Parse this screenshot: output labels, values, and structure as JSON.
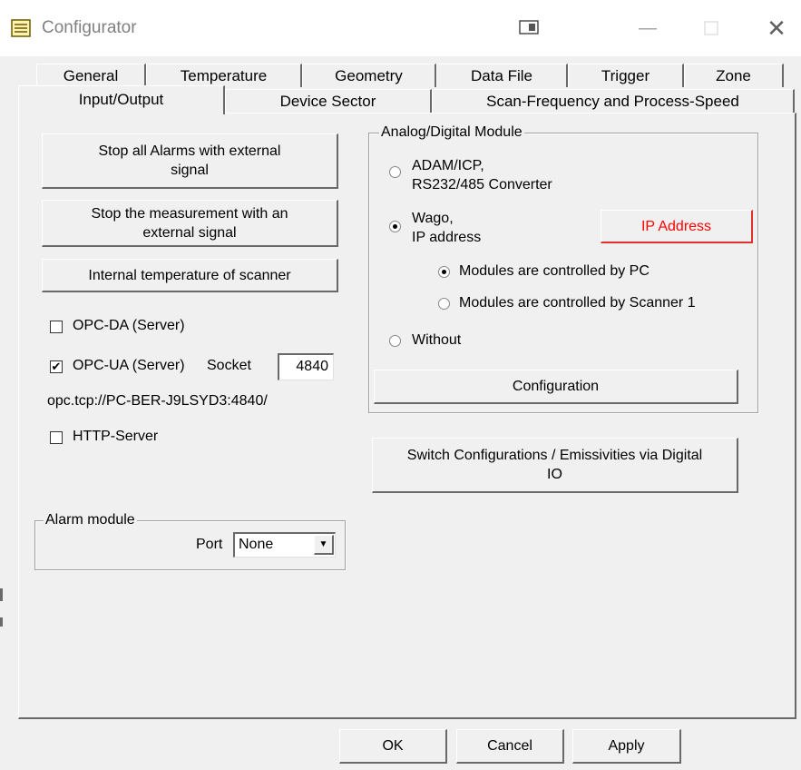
{
  "window": {
    "title": "Configurator",
    "minimize_glyph": "—",
    "close_glyph": "✕"
  },
  "tabs": {
    "row1": [
      "General",
      "Temperature",
      "Geometry",
      "Data File",
      "Trigger",
      "Zone"
    ],
    "row2": [
      "Input/Output",
      "Device Sector",
      "Scan-Frequency and Process-Speed"
    ],
    "active": "Input/Output"
  },
  "left": {
    "stop_alarms_label": "Stop all Alarms with external signal",
    "stop_measurement_label": "Stop the measurement with an external signal",
    "internal_temp_label": "Internal temperature of scanner",
    "opc_da": {
      "label": "OPC-DA (Server)",
      "checked": false
    },
    "opc_ua": {
      "label": "OPC-UA (Server)",
      "checked": true
    },
    "socket_label": "Socket",
    "socket_value": "4840",
    "opc_url": "opc.tcp://PC-BER-J9LSYD3:4840/",
    "http_server": {
      "label": "HTTP-Server",
      "checked": false
    }
  },
  "alarm_module": {
    "title": "Alarm module",
    "port_label": "Port",
    "port_value": "None"
  },
  "analog_digital": {
    "title": "Analog/Digital Module",
    "adam_label_line1": "ADAM/ICP,",
    "adam_label_line2": "RS232/485 Converter",
    "wago_label_line1": "Wago,",
    "wago_label_line2": "IP address",
    "ip_address_button": "IP Address",
    "modules_pc_label": "Modules are controlled by PC",
    "modules_scanner_label": "Modules are controlled by Scanner 1",
    "without_label": "Without",
    "configuration_button": "Configuration",
    "selected": "wago",
    "modules_selected": "pc"
  },
  "switch_configs_label": "Switch Configurations / Emissivities via Digital IO",
  "footer": {
    "ok": "OK",
    "cancel": "Cancel",
    "apply": "Apply"
  },
  "colors": {
    "ip_address_text": "#ff0000",
    "ip_address_border": "#e03030",
    "dialog_bg": "#f0f0f0"
  }
}
